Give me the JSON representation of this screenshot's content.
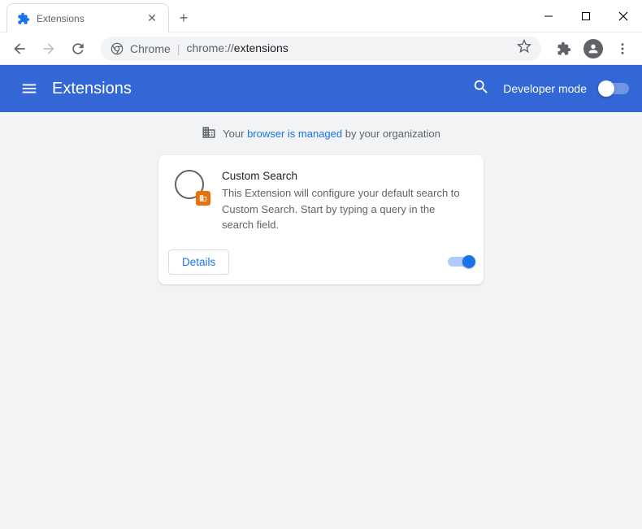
{
  "window": {
    "tab_title": "Extensions"
  },
  "omnibox": {
    "label": "Chrome",
    "scheme": "chrome://",
    "path": "extensions"
  },
  "header": {
    "title": "Extensions",
    "dev_mode_label": "Developer mode"
  },
  "managed": {
    "prefix": "Your ",
    "link": "browser is managed",
    "suffix": " by your organization"
  },
  "extension": {
    "name": "Custom Search",
    "description": "This Extension will configure your default search to Custom Search. Start by typing a query in the search field.",
    "details_label": "Details",
    "enabled": true
  }
}
